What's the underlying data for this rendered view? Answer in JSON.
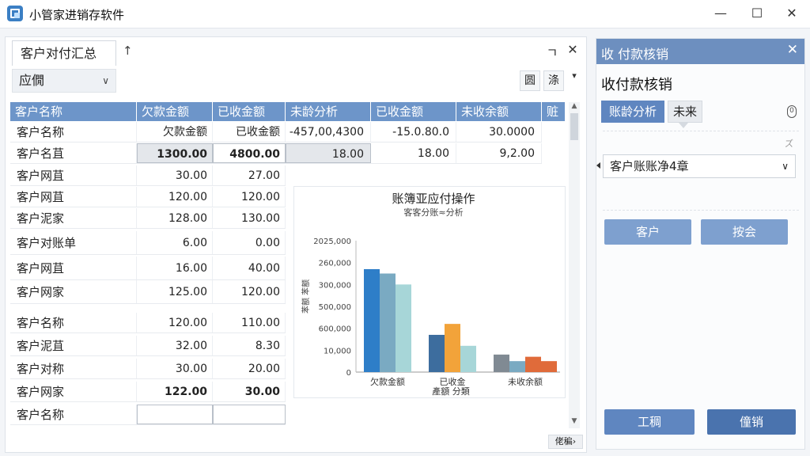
{
  "app": {
    "title": "小管家进销存软件"
  },
  "left": {
    "tab": "客户对付汇总",
    "tab_pin": "↑",
    "ctrl_restore": "ㄱ",
    "ctrl_close": "✕",
    "combo": "应僩",
    "tool1": "圆",
    "tool2": "涤",
    "dropdown": "▾",
    "page_btn": "佬稨›"
  },
  "grid": {
    "headers": [
      "客户名称",
      "欠款金额",
      "已收金额",
      "未龄分析",
      "已收金额",
      "未收余额",
      "赃"
    ],
    "top_rows": [
      [
        "客户名称",
        "欠款金额",
        "已收金额",
        "-457,00,4300",
        "-15.0.80.0",
        "30.0000"
      ],
      [
        "客户名苴",
        "1300.00",
        "4800.00",
        "18.00",
        "18.00",
        "9,2.00"
      ]
    ],
    "rows": [
      [
        "客户网苴",
        "30.00",
        "27.00"
      ],
      [
        "客户网苴",
        "120.00",
        "120.00"
      ],
      [
        "客户泥家",
        "128.00",
        "130.00"
      ],
      [
        "客户对账单",
        "6.00",
        "0.00"
      ],
      [
        "客户网苴",
        "16.00",
        "40.00"
      ],
      [
        "客户网家",
        "125.00",
        "120.00"
      ],
      [
        "客户名称",
        "120.00",
        "110.00"
      ],
      [
        "客户泥苴",
        "32.00",
        "8.30"
      ],
      [
        "客户对称",
        "30.00",
        "20.00"
      ],
      [
        "客户网家",
        "122.00",
        "30.00"
      ],
      [
        "客户名称",
        "",
        ""
      ]
    ]
  },
  "chart_data": {
    "type": "bar",
    "title": "账簿亚应付操作",
    "subtitle": "客客分账≈分析",
    "xlabel": "產額 分類",
    "ylabel": "苯额 苯额",
    "categories": [
      "欠款金额",
      "已收金",
      "未收余额"
    ],
    "yticks": [
      "2025,000",
      "260,000",
      "300,000",
      "500,000",
      "600,000",
      "10,000",
      "0"
    ],
    "series": [
      {
        "values": [
          47,
          45,
          40
        ],
        "color": "#2e7ec8"
      },
      {
        "values": [
          17,
          22,
          12
        ],
        "color": "#3d6d9e"
      },
      {
        "values": [
          8,
          5,
          5
        ],
        "color": "#808a93"
      }
    ],
    "bar_colors": {
      "欠款金额": [
        "#2e7ec8",
        "#7aaac2",
        "#a7d6d8"
      ],
      "已收金": [
        "#3d6d9e",
        "#f2a33a",
        "#a7d6d8"
      ],
      "未收余额": [
        "#808a93",
        "#7aaac2",
        "#e06b3a",
        "#e06b3a"
      ]
    },
    "groups": [
      {
        "category": "欠款金额",
        "values": [
          47,
          45,
          40
        ]
      },
      {
        "category": "已收金",
        "values": [
          17,
          22,
          12
        ]
      },
      {
        "category": "未收余额",
        "values": [
          8,
          5,
          7,
          5
        ]
      }
    ],
    "ylim": [
      0,
      60
    ],
    "grid": false
  },
  "right": {
    "head_title": "收 付款核销",
    "close": "✕",
    "title": "收付款核销",
    "seg_active": "账龄分析",
    "seg_other": "未来",
    "info": "0",
    "tiny_x": "ズ",
    "select_value": "客户账账净4章",
    "btn_customer": "客户",
    "btn_query": "按会",
    "btn_work": "工稠",
    "btn_writeoff": "僮销"
  },
  "colors": {
    "accent": "#5f86c0",
    "header": "#6d95c9",
    "button_light": "#7ea0cf",
    "button_dark": "#4f77b3"
  }
}
